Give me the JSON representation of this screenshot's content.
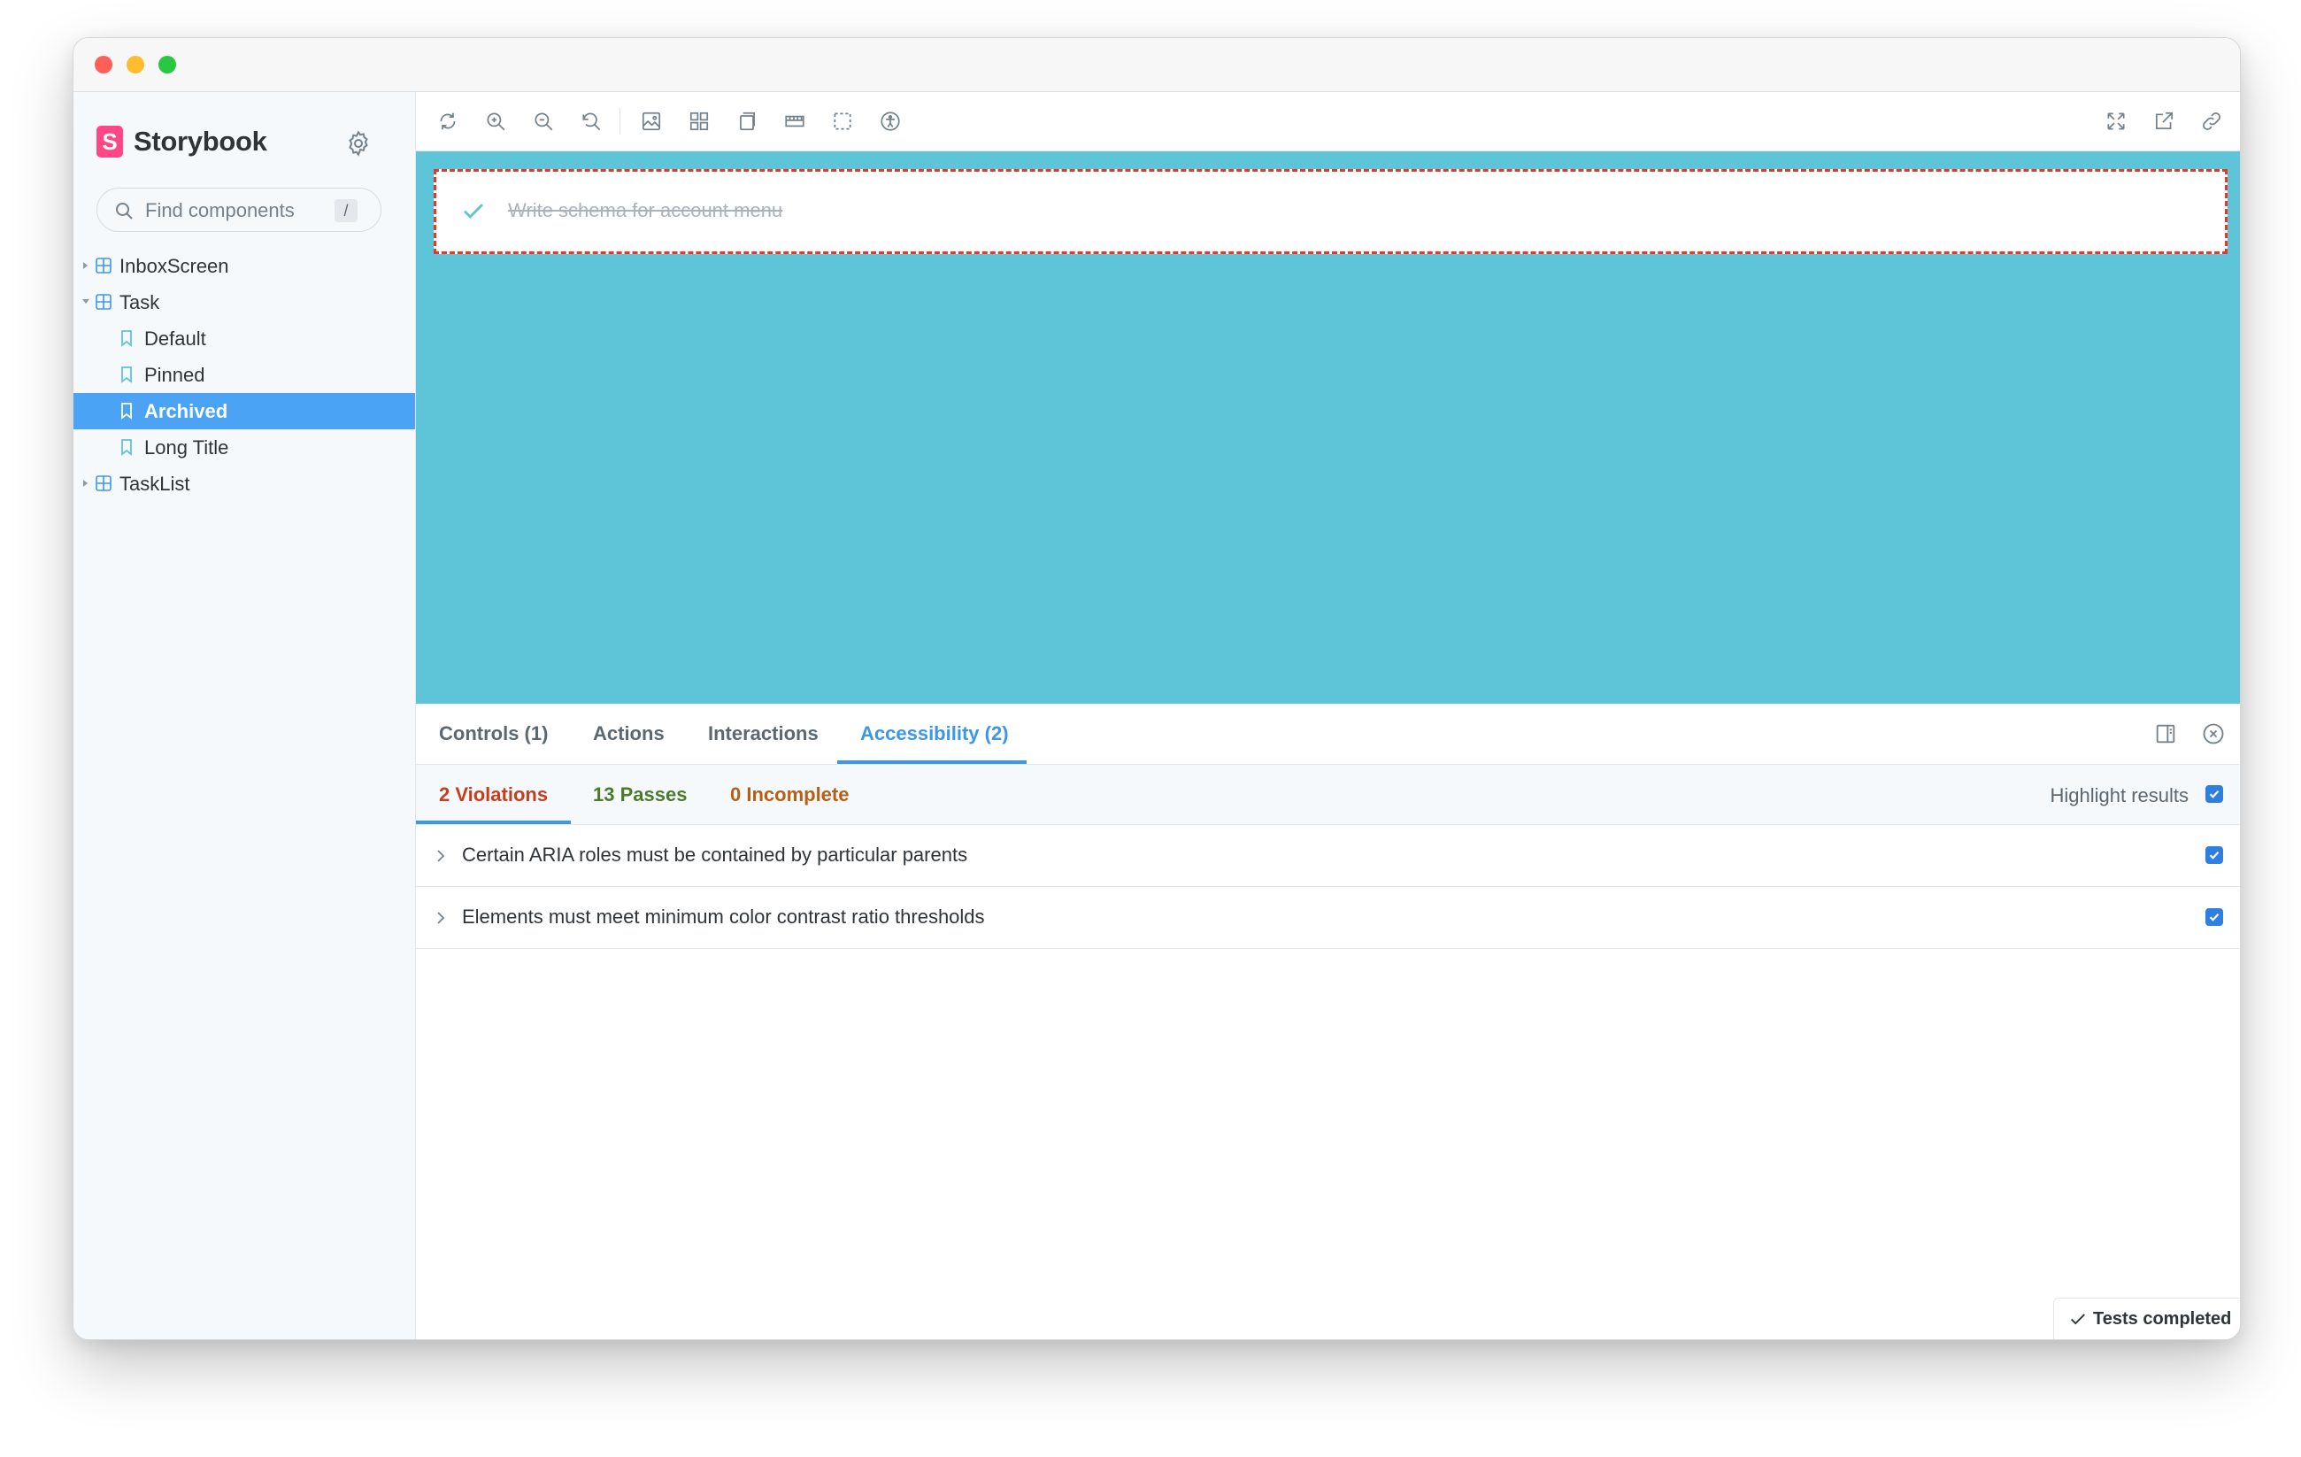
{
  "app": {
    "name": "Storybook",
    "logo_letter": "S",
    "accent_color": "#ff4785",
    "selection_color": "#4aa3f4"
  },
  "sidebar": {
    "search": {
      "placeholder": "Find components",
      "shortcut": "/"
    },
    "tree": [
      {
        "label": "InboxScreen",
        "kind": "component",
        "expanded": false
      },
      {
        "label": "Task",
        "kind": "component",
        "expanded": true
      },
      {
        "label": "Default",
        "kind": "story"
      },
      {
        "label": "Pinned",
        "kind": "story"
      },
      {
        "label": "Archived",
        "kind": "story",
        "selected": true
      },
      {
        "label": "Long Title",
        "kind": "story"
      },
      {
        "label": "TaskList",
        "kind": "component",
        "expanded": false
      }
    ]
  },
  "toolbar": {
    "left_tools": [
      "reload-icon",
      "zoom-in-icon",
      "zoom-out-icon",
      "zoom-reset-icon",
      "background-icon",
      "grid-icon",
      "viewport-icon",
      "ruler-icon",
      "outline-icon",
      "accessibility-icon"
    ],
    "right_tools": [
      "fullscreen-icon",
      "open-new-tab-icon",
      "copy-link-icon"
    ]
  },
  "preview": {
    "background_color": "#5ec4d8",
    "task_title": "Write schema for account menu",
    "task_state": "archived"
  },
  "panel": {
    "tabs": [
      {
        "label": "Controls (1)",
        "active": false
      },
      {
        "label": "Actions",
        "active": false
      },
      {
        "label": "Interactions",
        "active": false
      },
      {
        "label": "Accessibility (2)",
        "active": true
      }
    ],
    "a11y": {
      "subtabs": [
        {
          "label": "2 Violations",
          "color": "#c43f1e",
          "active": true
        },
        {
          "label": "13 Passes",
          "color": "#4b7a2b",
          "active": false
        },
        {
          "label": "0 Incomplete",
          "color": "#b75f13",
          "active": false
        }
      ],
      "highlight_label": "Highlight results",
      "highlight_checked": true,
      "violations": [
        {
          "text": "Certain ARIA roles must be contained by particular parents",
          "checked": true
        },
        {
          "text": "Elements must meet minimum color contrast ratio thresholds",
          "checked": true
        }
      ],
      "status": "Tests completed"
    }
  }
}
